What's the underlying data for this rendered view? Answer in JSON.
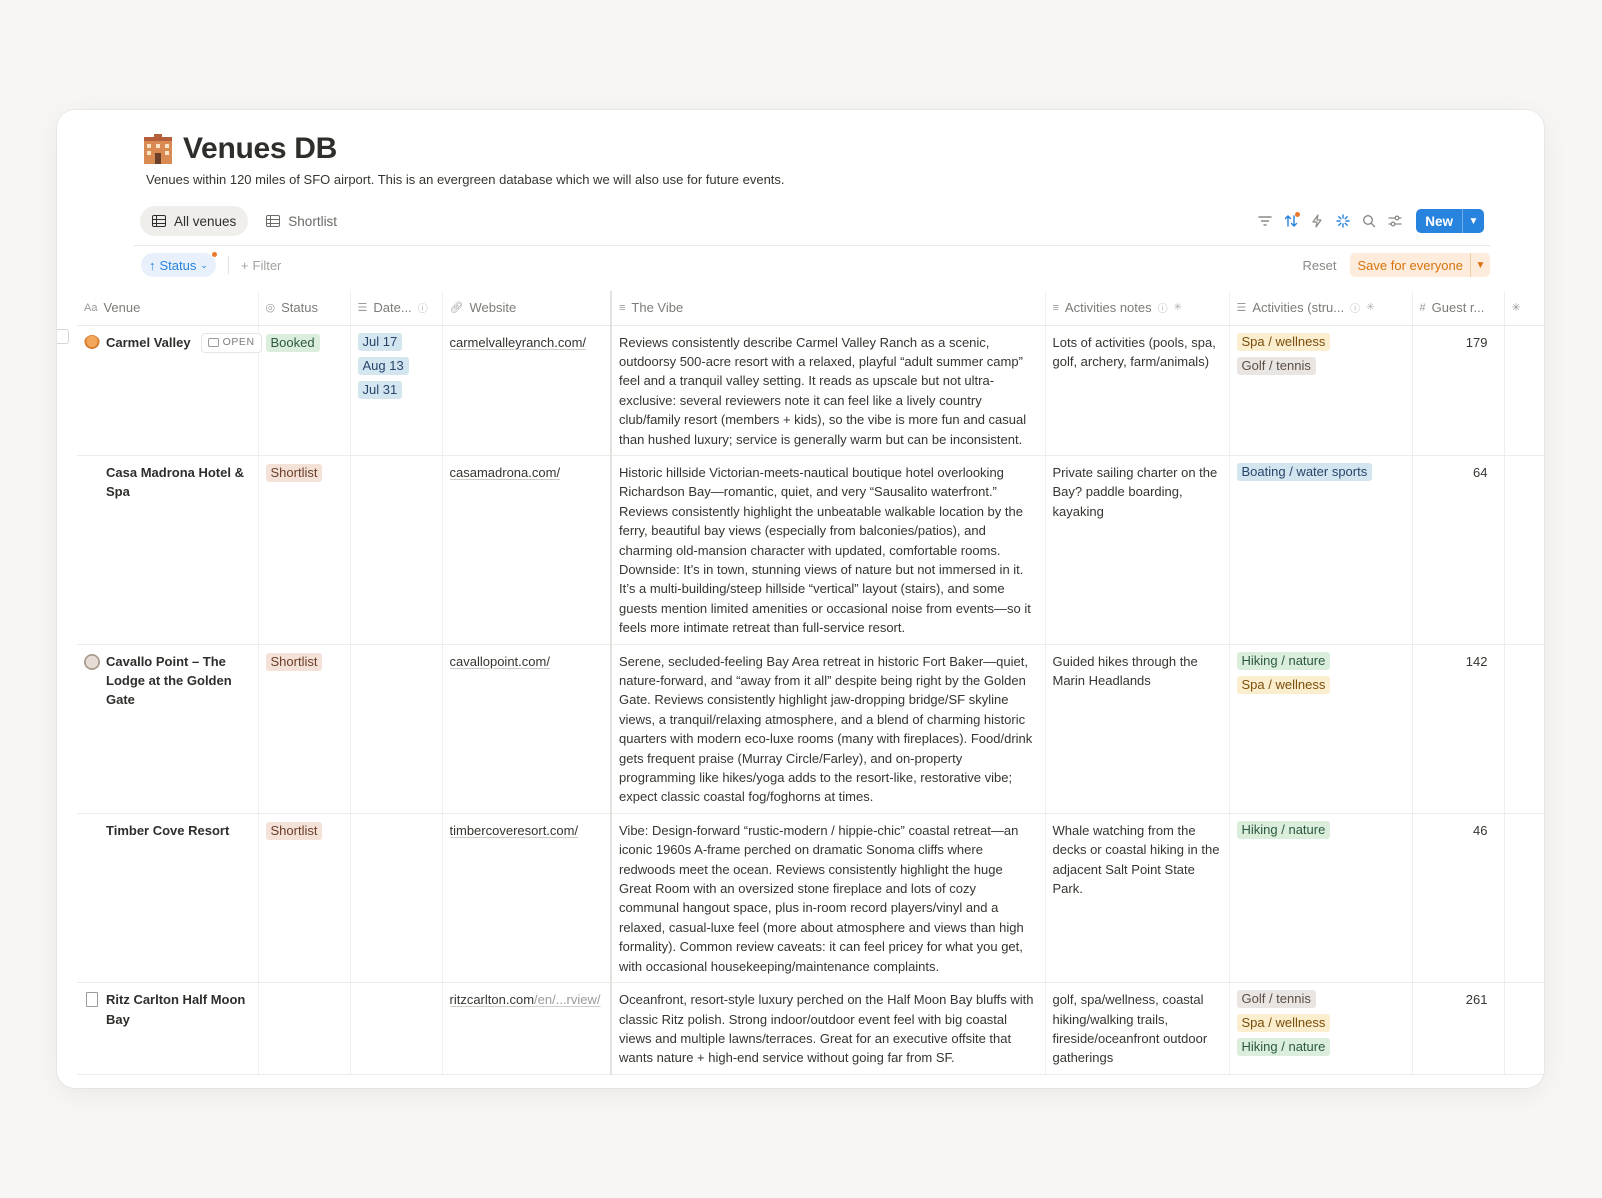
{
  "page": {
    "title": "Venues DB",
    "description": "Venues within 120 miles of SFO airport. This is an evergreen database which we will also use for future events."
  },
  "views": [
    {
      "label": "All venues",
      "active": true
    },
    {
      "label": "Shortlist",
      "active": false
    }
  ],
  "toolbar": {
    "icons": [
      "filter-icon",
      "sort-icon",
      "automation-icon",
      "ai-icon",
      "search-icon",
      "settings-icon"
    ],
    "new_label": "New",
    "accent": "#2783de"
  },
  "filters": {
    "sort_label": "Status",
    "add_filter": "Filter",
    "reset_label": "Reset",
    "save_label": "Save for everyone"
  },
  "columns": {
    "venue": "Venue",
    "status": "Status",
    "date": "Date...",
    "website": "Website",
    "vibe": "The Vibe",
    "notes": "Activities notes",
    "activities": "Activities (stru...",
    "guests": "Guest r..."
  },
  "open_label": "OPEN",
  "rows": [
    {
      "venue": "Carmel Valley",
      "status": "Booked",
      "dates": [
        "Jul 17",
        "Aug 13",
        "Jul 31"
      ],
      "website": "carmelvalleyranch.com/",
      "vibe": "Reviews consistently describe Carmel Valley Ranch as a scenic, outdoorsy 500-acre resort with a relaxed, playful “adult summer camp” feel and a tranquil valley setting. It reads as upscale but not ultra-exclusive: several reviewers note it can feel like a lively country club/family resort (members + kids), so the vibe is more fun and casual than hushed luxury; service is generally warm but can be inconsistent.",
      "notes": "Lots of activities (pools, spa, golf, archery, farm/animals)",
      "activities": [
        "Spa / wellness",
        "Golf / tennis"
      ],
      "guests": "179"
    },
    {
      "venue": "Casa Madrona Hotel & Spa",
      "status": "Shortlist",
      "dates": [],
      "website": "casamadrona.com/",
      "vibe": "Historic hillside Victorian-meets-nautical boutique hotel overlooking Richardson Bay—romantic, quiet, and very “Sausalito waterfront.” Reviews consistently highlight the unbeatable walkable location by the ferry, beautiful bay views (especially from balconies/patios), and charming old-mansion character with updated, comfortable rooms. Downside: It’s in town, stunning views of nature but not immersed in it. It’s a multi-building/steep hillside “vertical” layout (stairs), and some guests mention limited amenities or occasional noise from events—so it feels more intimate retreat than full-service resort.",
      "notes": "Private sailing charter on the Bay? paddle boarding, kayaking",
      "activities": [
        "Boating / water sports"
      ],
      "guests": "64"
    },
    {
      "venue": "Cavallo Point – The Lodge at the Golden Gate",
      "status": "Shortlist",
      "dates": [],
      "website": "cavallopoint.com/",
      "vibe": "Serene, secluded-feeling Bay Area retreat in historic Fort Baker—quiet, nature-forward, and “away from it all” despite being right by the Golden Gate. Reviews consistently highlight jaw-dropping bridge/SF skyline views, a tranquil/relaxing atmosphere, and a blend of charming historic quarters with modern eco-luxe rooms (many with fireplaces). Food/drink gets frequent praise (Murray Circle/Farley), and on-property programming like hikes/yoga adds to the resort-like, restorative vibe; expect classic coastal fog/foghorns at times.",
      "notes": "Guided hikes through the Marin Headlands",
      "activities": [
        "Hiking / nature",
        "Spa / wellness"
      ],
      "guests": "142"
    },
    {
      "venue": "Timber Cove Resort",
      "status": "Shortlist",
      "dates": [],
      "website": "timbercoveresort.com/",
      "vibe": "Vibe: Design-forward “rustic-modern / hippie-chic” coastal retreat—an iconic 1960s A-frame perched on dramatic Sonoma cliffs where redwoods meet the ocean. Reviews consistently highlight the huge Great Room with an oversized stone fireplace and lots of cozy communal hangout space, plus in-room record players/vinyl and a relaxed, casual-luxe feel (more about atmosphere and views than high formality). Common review caveats: it can feel pricey for what you get, with occasional housekeeping/maintenance complaints.",
      "notes": "Whale watching from the decks or coastal hiking in the adjacent Salt Point State Park.",
      "activities": [
        "Hiking / nature"
      ],
      "guests": "46"
    },
    {
      "venue": "Ritz Carlton Half Moon Bay",
      "status": "",
      "dates": [],
      "website": "ritzcarlton.com",
      "website_dim": "/en/...rview/",
      "vibe": "Oceanfront, resort-style luxury perched on the Half Moon Bay bluffs with classic Ritz polish. Strong indoor/outdoor event feel with big coastal views and multiple lawns/terraces. Great for an executive offsite that wants nature + high-end service without going far from SF.",
      "notes": "golf, spa/wellness, coastal hiking/walking trails, fireside/oceanfront outdoor gatherings",
      "activities": [
        "Golf / tennis",
        "Spa / wellness",
        "Hiking / nature"
      ],
      "guests": "261"
    }
  ]
}
